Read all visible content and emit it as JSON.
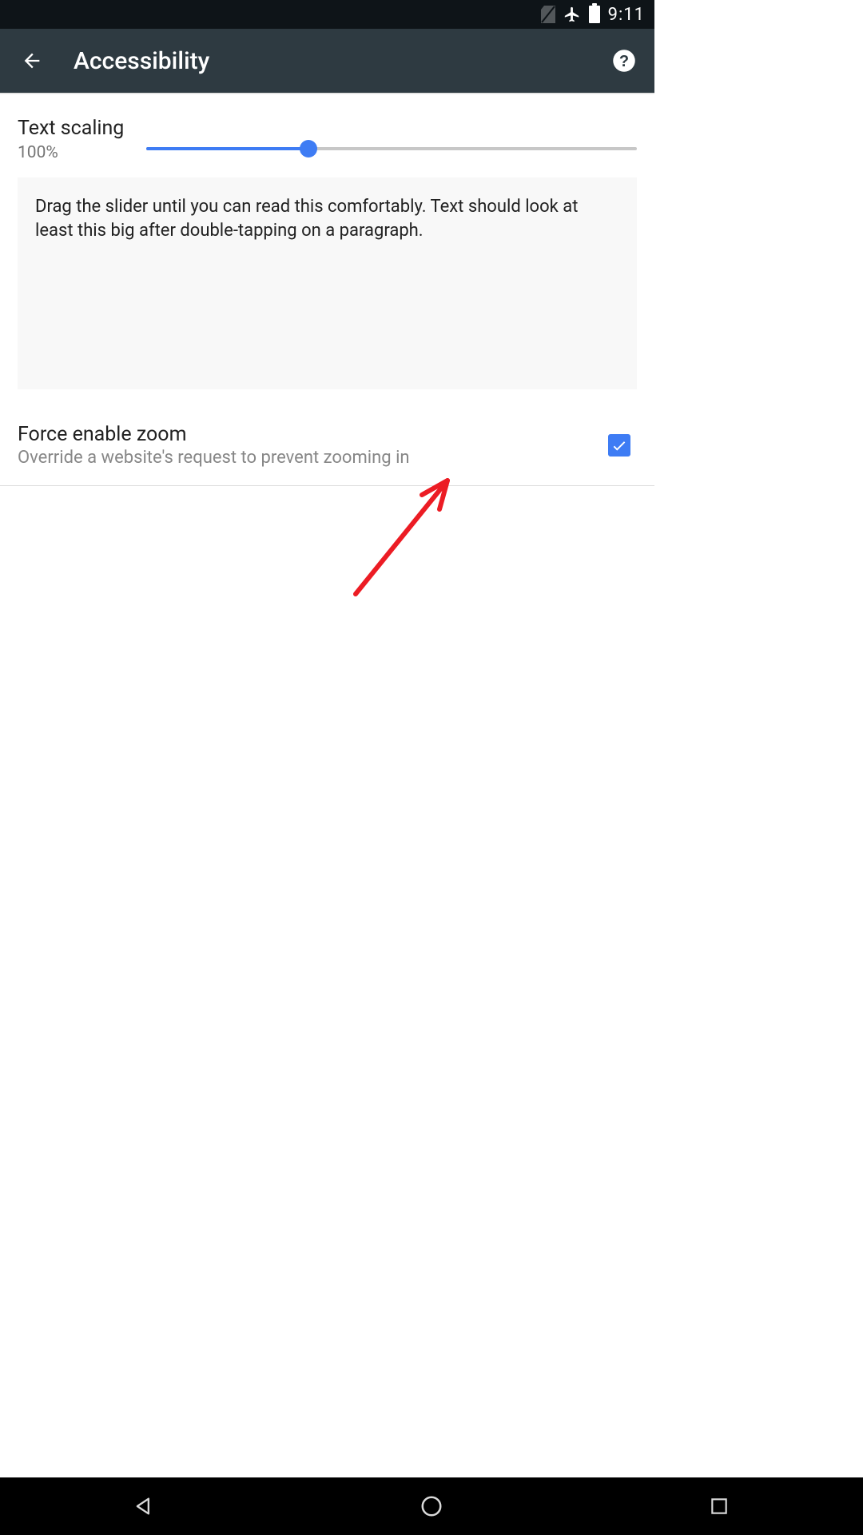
{
  "status": {
    "time": "9:11"
  },
  "appbar": {
    "title": "Accessibility"
  },
  "text_scaling": {
    "label": "Text scaling",
    "value_text": "100%",
    "value_pct": 33
  },
  "preview": {
    "text": "Drag the slider until you can read this comfortably. Text should look at least this big after double-tapping on a paragraph."
  },
  "force_zoom": {
    "title": "Force enable zoom",
    "subtitle": "Override a website's request to prevent zooming in",
    "checked": true
  }
}
